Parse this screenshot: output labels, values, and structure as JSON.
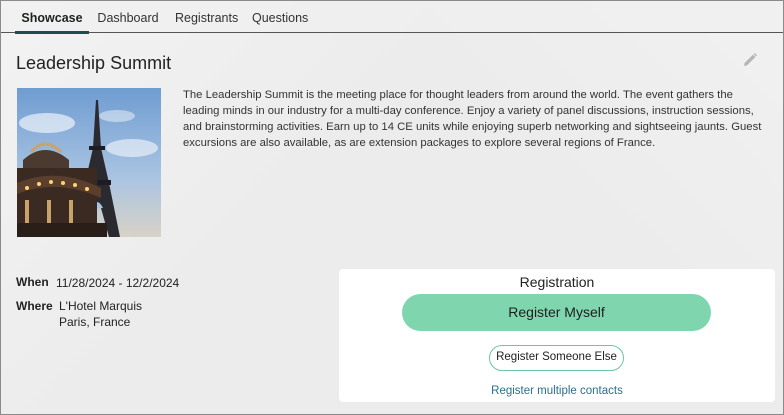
{
  "tabs": [
    {
      "label": "Showcase",
      "active": true
    },
    {
      "label": "Dashboard",
      "active": false
    },
    {
      "label": "Registrants",
      "active": false
    },
    {
      "label": "Questions",
      "active": false
    }
  ],
  "event": {
    "title": "Leadership Summit",
    "description": "The Leadership Summit is the meeting place for thought leaders from around the world. The event gathers the leading minds in our industry for a multi-day conference. Enjoy a variety of panel discussions, instruction sessions, and brainstorming activities. Earn up to 14 CE units while enjoying superb networking and sightseeing jaunts. Guest excursions are also available, as are extension packages to explore several regions of France.",
    "when_label": "When",
    "when_value": "11/28/2024 - 12/2/2024",
    "where_label": "Where",
    "where_line1": "L'Hotel Marquis",
    "where_line2": "Paris, France"
  },
  "registration": {
    "heading": "Registration",
    "primary_button": "Register Myself",
    "secondary_button": "Register Someone Else",
    "link": "Register multiple contacts"
  },
  "colors": {
    "accent": "#7fd6ae",
    "tab_underline": "#1f4d4e",
    "link": "#2a6f8f"
  },
  "icons": {
    "edit": "pencil-icon"
  }
}
